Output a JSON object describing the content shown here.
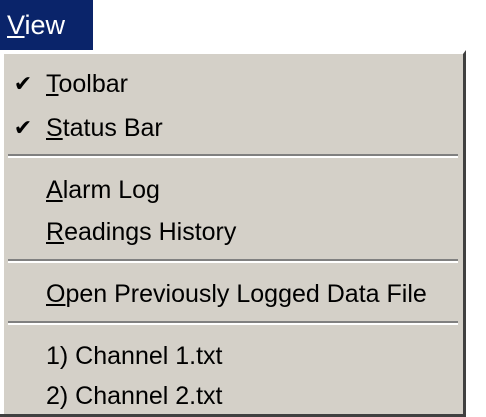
{
  "menu": {
    "title": "View",
    "title_mnemonic": "V",
    "title_rest": "iew"
  },
  "items": [
    {
      "mnemonic": "T",
      "rest": "oolbar",
      "checked": true,
      "check_glyph": "✔"
    },
    {
      "mnemonic": "S",
      "rest": "tatus Bar",
      "checked": true,
      "check_glyph": "✔"
    },
    {
      "mnemonic": "A",
      "rest": "larm Log",
      "checked": false
    },
    {
      "mnemonic": "R",
      "rest": "eadings History",
      "checked": false
    },
    {
      "mnemonic": "O",
      "rest": "pen Previously Logged Data File",
      "checked": false
    },
    {
      "label": "1) Channel 1.txt"
    },
    {
      "label": "2) Channel 2.txt"
    }
  ],
  "colors": {
    "menu_highlight": "#0a246a",
    "menu_background": "#d4d0c8"
  }
}
